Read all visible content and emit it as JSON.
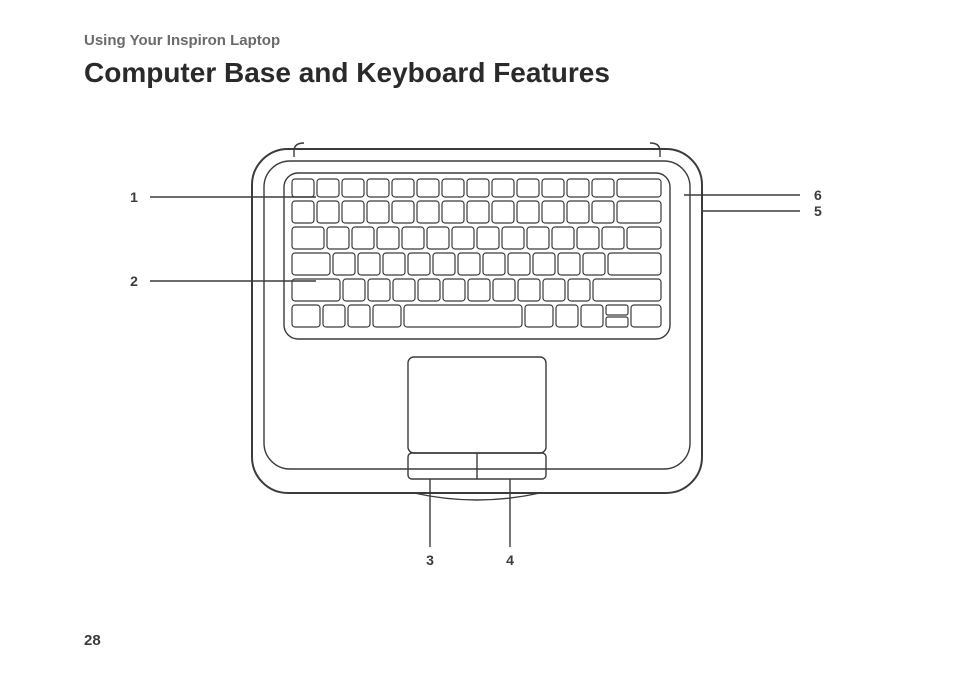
{
  "header": "Using Your Inspiron Laptop",
  "title": "Computer Base and Keyboard Features",
  "page_number": "28",
  "callouts": {
    "c1": "1",
    "c2": "2",
    "c3": "3",
    "c4": "4",
    "c5": "5",
    "c6": "6"
  }
}
